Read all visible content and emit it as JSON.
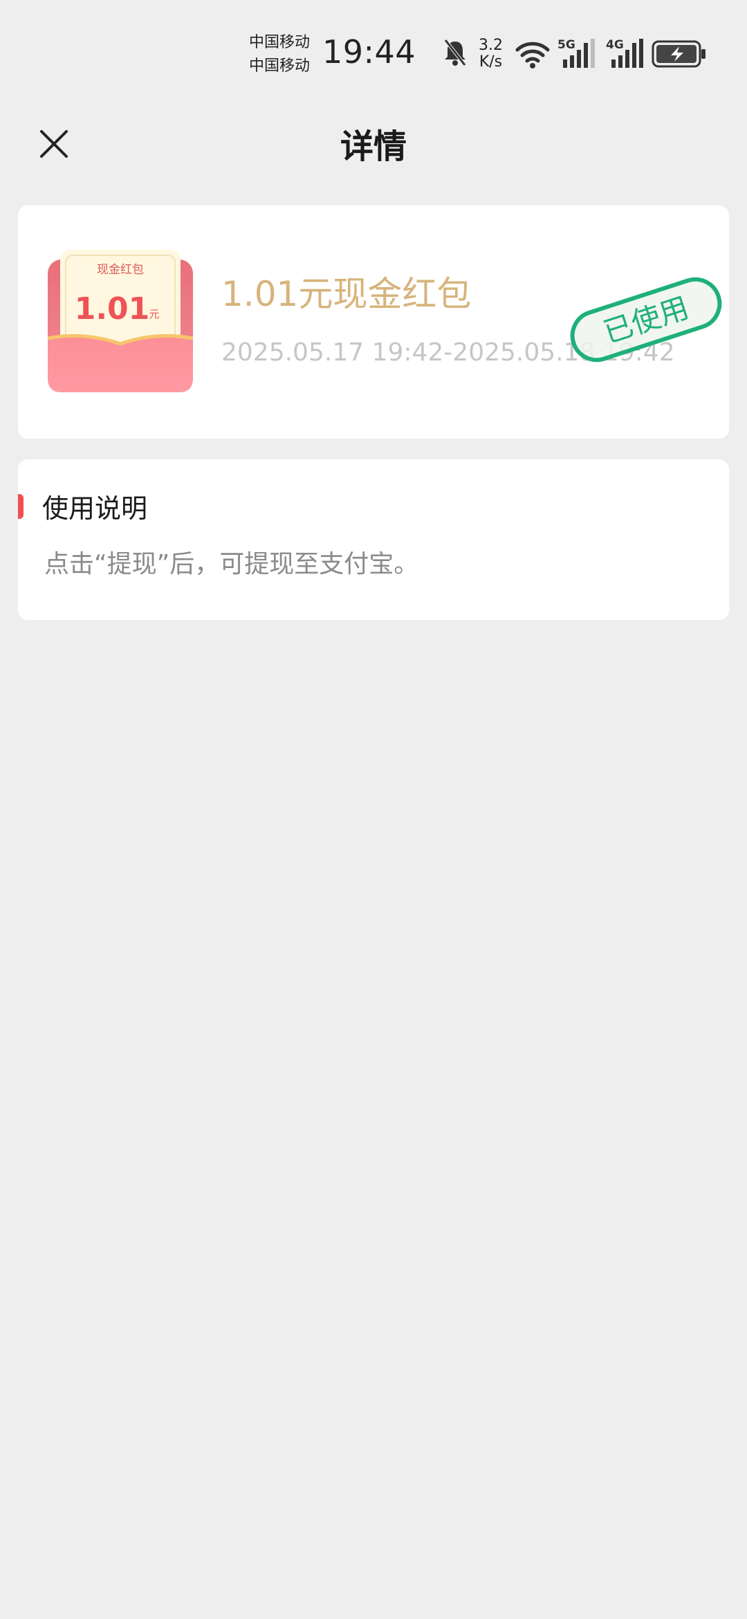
{
  "status_bar": {
    "carrier_1": "中国移动",
    "carrier_2": "中国移动",
    "time": "19:44",
    "speed_value": "3.2",
    "speed_unit": "K/s",
    "net_5g": "5G",
    "net_4g": "4G",
    "icons": [
      "bell-muted-icon",
      "wifi-icon",
      "signal-5g-icon",
      "signal-4g-icon",
      "battery-charging-icon"
    ]
  },
  "header": {
    "title": "详情",
    "close_icon": "close-icon"
  },
  "coupon": {
    "envelope_label": "现金红包",
    "envelope_amount": "1.01",
    "envelope_unit": "元",
    "title": "1.01元现金红包",
    "validity": "2025.05.17 19:42-2025.05.18 19:42",
    "stamp_text": "已使用",
    "colors": {
      "title": "#d7b47c",
      "stamp": "#1fb07a",
      "envelope": "#f47c86"
    }
  },
  "usage": {
    "title": "使用说明",
    "text": "点击“提现”后，可提现至支付宝。"
  }
}
